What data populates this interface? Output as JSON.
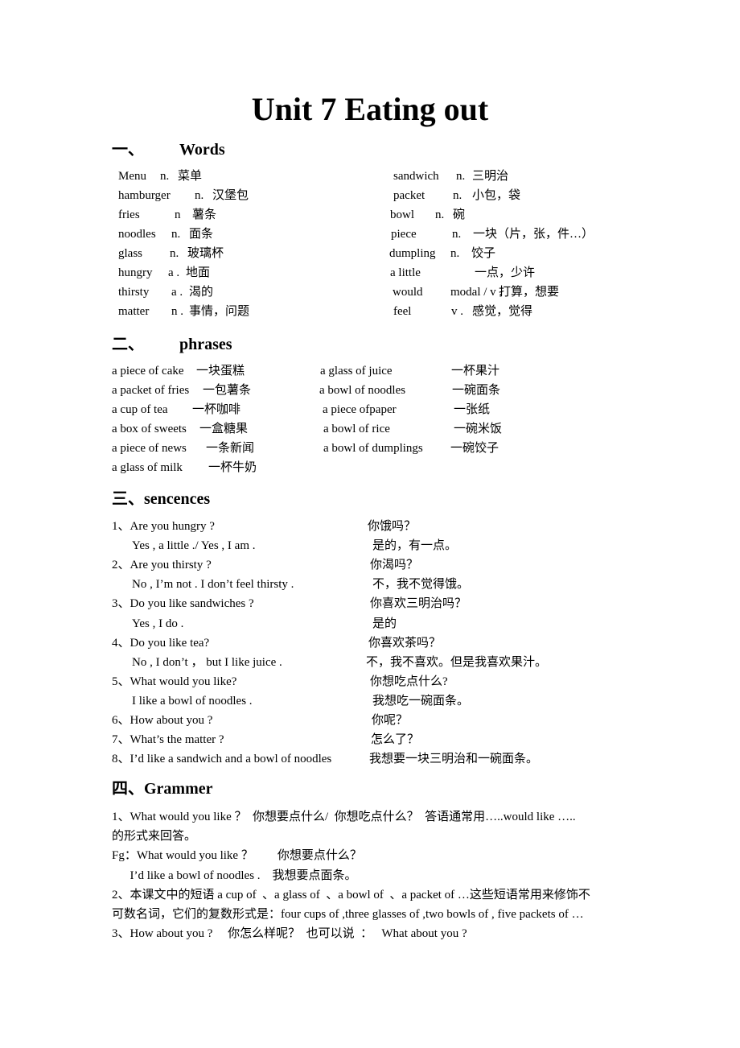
{
  "title": "Unit 7 Eating out",
  "sections": {
    "words": {
      "num": "一、",
      "label": "Words"
    },
    "phrases": {
      "num": "二、",
      "label": "phrases"
    },
    "sentences": {
      "num": "三、",
      "label": "sencences"
    },
    "grammar": {
      "num": "四、",
      "label": "Grammer"
    }
  },
  "words_left": [
    {
      "word": "Menu",
      "pos": "n.",
      "meaning": "菜单"
    },
    {
      "word": "hamburger",
      "pos": "n.",
      "meaning": "汉堡包"
    },
    {
      "word": "fries",
      "pos": "n",
      "meaning": "薯条"
    },
    {
      "word": "noodles",
      "pos": "n.",
      "meaning": "面条"
    },
    {
      "word": "glass",
      "pos": "n.",
      "meaning": "玻璃杯"
    },
    {
      "word": "hungry",
      "pos": "a .",
      "meaning": "地面"
    },
    {
      "word": "thirsty",
      "pos": "a .",
      "meaning": "渴的"
    },
    {
      "word": "matter",
      "pos": "n .",
      "meaning": "事情，问题"
    }
  ],
  "words_right": [
    {
      "word": "sandwich",
      "pos": "n.",
      "meaning": "三明治"
    },
    {
      "word": "packet",
      "pos": "n.",
      "meaning": "小包，袋"
    },
    {
      "word": "bowl",
      "pos": "n.",
      "meaning": "碗"
    },
    {
      "word": "piece",
      "pos": "n.",
      "meaning": "一块（片，张，件…）"
    },
    {
      "word": "dumpling",
      "pos": "n.",
      "meaning": "饺子"
    },
    {
      "word": "a little",
      "pos": "",
      "meaning": "一点，少许"
    },
    {
      "word": "would",
      "pos": "modal / v .",
      "meaning": "打算，想要"
    },
    {
      "word": "feel",
      "pos": "v .",
      "meaning": "感觉，觉得"
    }
  ],
  "phrases_left": [
    {
      "en": "a piece of cake",
      "zh": "一块蛋糕"
    },
    {
      "en": "a packet of fries",
      "zh": "一包薯条"
    },
    {
      "en": "a cup of tea",
      "zh": "一杯咖啡"
    },
    {
      "en": "a box of sweets",
      "zh": "一盒糖果"
    },
    {
      "en": "a piece of news",
      "zh": "一条新闻"
    },
    {
      "en": "a glass of milk",
      "zh": "一杯牛奶"
    }
  ],
  "phrases_right": [
    {
      "en": "a glass of juice",
      "zh": "一杯果汁"
    },
    {
      "en": "a bowl of noodles",
      "zh": "一碗面条"
    },
    {
      "en": "a piece ofpaper",
      "zh": "一张纸"
    },
    {
      "en": "a bowl of rice",
      "zh": "一碗米饭"
    },
    {
      "en": "a bowl of dumplings",
      "zh": "一碗饺子"
    }
  ],
  "sentences": [
    {
      "en": "1、Are you hungry ?",
      "zh": "你饿吗？",
      "indent": false
    },
    {
      "en": "Yes , a little ./ Yes , I am .",
      "zh": "是的，有一点。",
      "indent": true
    },
    {
      "en": "2、Are you thirsty ?",
      "zh": "你渴吗？",
      "indent": false
    },
    {
      "en": "No , I’m not . I don’t feel thirsty .",
      "zh": "不，我不觉得饿。",
      "indent": true
    },
    {
      "en": "3、Do you like sandwiches ?",
      "zh": "你喜欢三明治吗？",
      "indent": false
    },
    {
      "en": "Yes , I do .",
      "zh": "是的",
      "indent": true
    },
    {
      "en": "4、Do you like tea?",
      "zh": "你喜欢茶吗？",
      "indent": false
    },
    {
      "en": "No , I don’t ， but I like juice .",
      "zh": "不，我不喜欢。但是我喜欢果汁。",
      "indent": true
    },
    {
      "en": "5、What would you like?",
      "zh": "你想吃点什么?",
      "indent": false
    },
    {
      "en": "I like a bowl of noodles .",
      "zh": "我想吃一碗面条。",
      "indent": true
    },
    {
      "en": "6、How about you ?",
      "zh": "你呢？",
      "indent": false
    },
    {
      "en": "7、What’s the matter ?",
      "zh": "怎么了？",
      "indent": false
    },
    {
      "en": "8、I’d like a sandwich and a bowl of noodles",
      "zh": "我想要一块三明治和一碗面条。",
      "indent": false
    }
  ],
  "grammar": [
    "1、What would you like ？  你想要点什么/  你想吃点什么？  答语通常用…..would like …..",
    "的形式来回答。",
    "Fg：What would you like ？        你想要点什么？",
    "      I’d like a bowl of noodles .    我想要点面条。",
    "2、本课文中的短语 a cup of  、a glass of  、a bowl of  、a packet of …这些短语常用来修饰不",
    "可数名词，它们的复数形式是：four cups of ,three glasses of ,two bowls of , five packets of …",
    "3、How about you ?     你怎么样呢？  也可以说  ：   What about you ?"
  ]
}
